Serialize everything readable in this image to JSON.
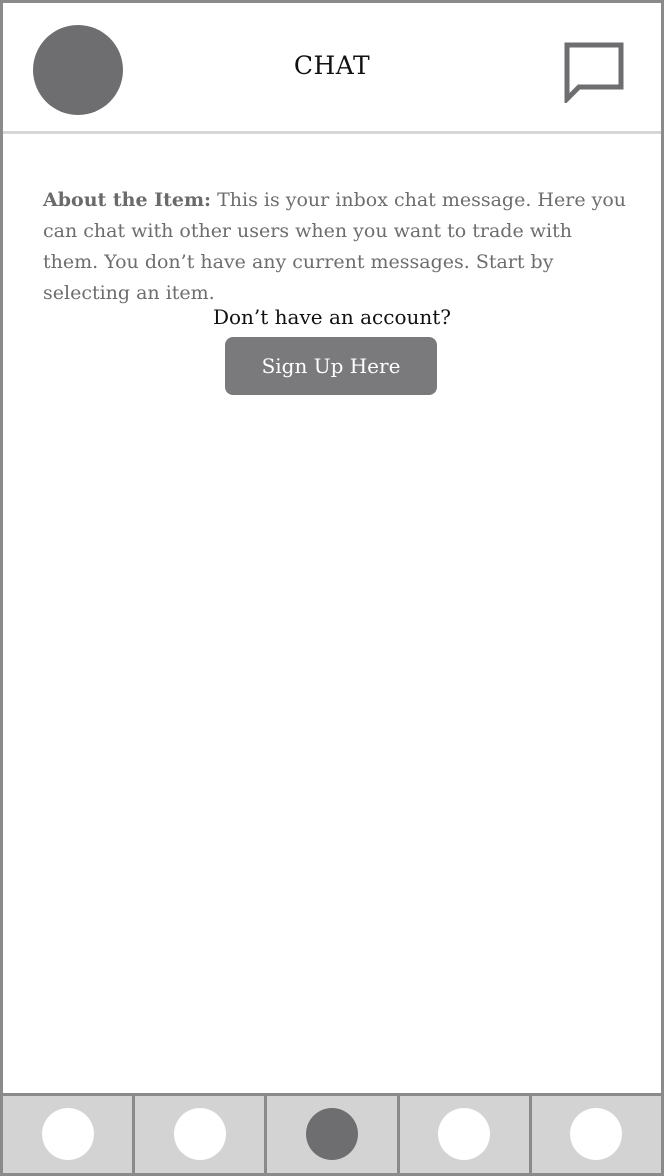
{
  "header": {
    "title": "CHAT",
    "avatar_icon": "profile-avatar",
    "chat_icon": "chat-bubble-icon"
  },
  "main": {
    "about_label": "About the Item:",
    "about_text": " This is your inbox chat message. Here you can chat with other users when you want to trade with them. You don’t have any current messages. Start by selecting an item.",
    "account_prompt": "Don’t have an account?",
    "signup_label": "Sign Up Here"
  },
  "bottom_nav": {
    "items": [
      {
        "icon": "nav-tab-1-icon",
        "active": false
      },
      {
        "icon": "nav-tab-2-icon",
        "active": false
      },
      {
        "icon": "nav-tab-3-icon",
        "active": true
      },
      {
        "icon": "nav-tab-4-icon",
        "active": false
      },
      {
        "icon": "nav-tab-5-icon",
        "active": false
      }
    ]
  },
  "colors": {
    "dark_gray": "#6e6e70",
    "button_gray": "#7a7a7c",
    "nav_bg": "#d3d3d3",
    "frame_border": "#8a8a8a",
    "divider": "#d6d6d6"
  }
}
